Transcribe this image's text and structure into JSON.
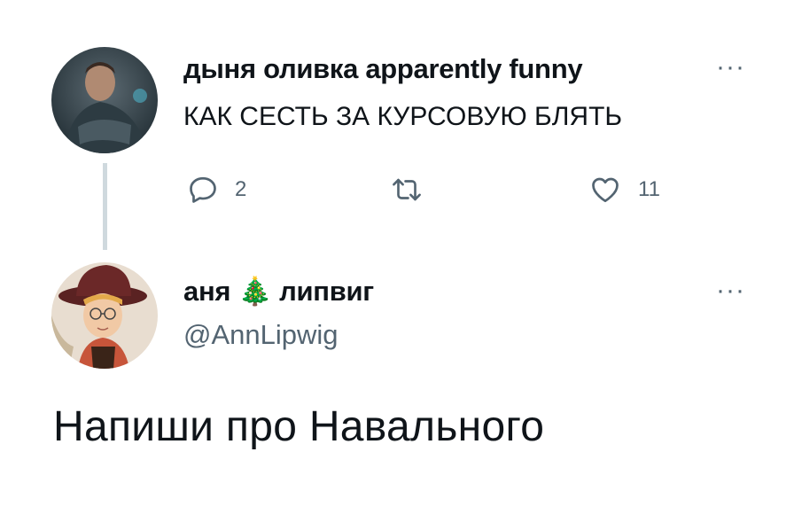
{
  "tweet1": {
    "display_name": "дыня оливка apparently funny",
    "text": "КАК СЕСТЬ ЗА КУРСОВУЮ БЛЯТЬ",
    "replies": "2",
    "retweets": "",
    "likes": "11",
    "more": "···"
  },
  "tweet2": {
    "display_name_part1": "аня",
    "emoji": "🎄",
    "display_name_part2": "липвиг",
    "handle": "@AnnLipwig",
    "text": "Напиши про Навального",
    "more": "···"
  },
  "icons": {
    "reply": "reply-icon",
    "retweet": "retweet-icon",
    "like": "heart-icon",
    "more": "more-icon"
  },
  "colors": {
    "text": "#0f1419",
    "secondary": "#536471",
    "thread_line": "#cfd9de"
  }
}
